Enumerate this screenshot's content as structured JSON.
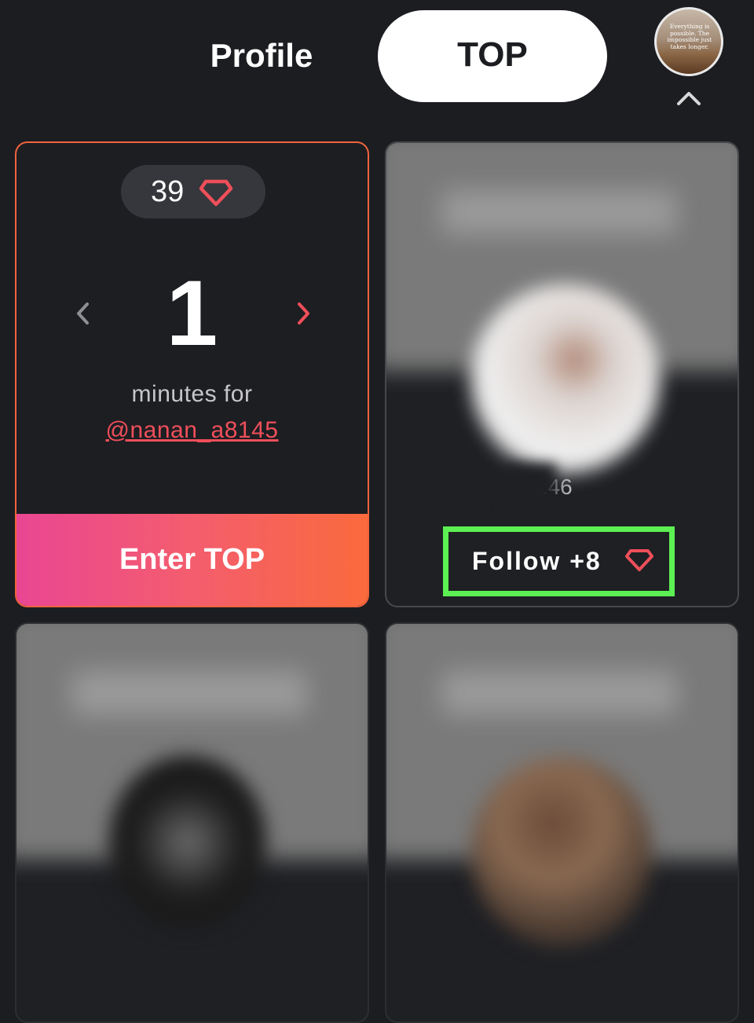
{
  "header": {
    "profile_tab_label": "Profile",
    "top_tab_label": "TOP",
    "avatar_caption": "Everything is possible. The impossible just takes longer."
  },
  "top_card": {
    "gem_count": "39",
    "minutes_value": "1",
    "minutes_label": "minutes for",
    "username": "@nanan_a8145",
    "enter_button_label": "Enter TOP"
  },
  "suggested_card": {
    "time_partial": ":.46",
    "follow_label": "Follow +8"
  },
  "colors": {
    "accent_red": "#ef4f5a",
    "highlight_green": "#5cf052",
    "gradient_start": "#ea4693",
    "gradient_end": "#fa6a3c",
    "background": "#1c1d21"
  },
  "icons": {
    "gem": "gem-icon",
    "chevron_left": "chevron-left-icon",
    "chevron_right": "chevron-right-icon",
    "chevron_up": "chevron-up-icon"
  }
}
